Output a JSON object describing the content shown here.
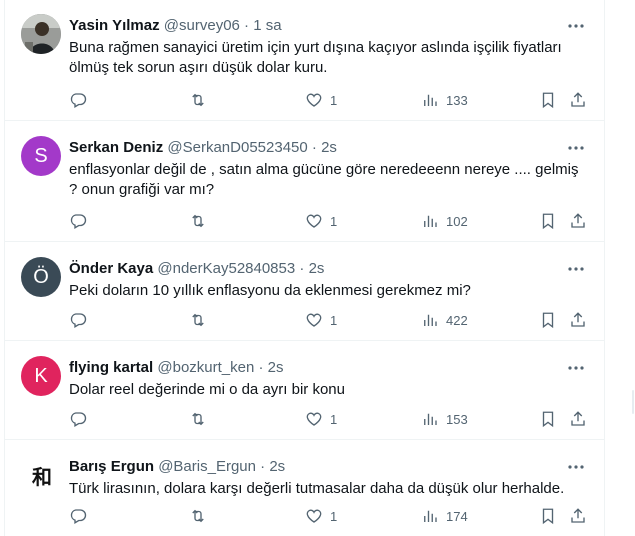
{
  "tweets": [
    {
      "name": "Yasin Yılmaz",
      "handle": "@survey06",
      "sep": "·",
      "time": "1 sa",
      "text": "Buna rağmen sanayici üretim için yurt dışına kaçıyor aslında işçilik fiyatları ölmüş tek sorun aşırı düşük dolar kuru.",
      "likes": "1",
      "views": "133",
      "avatar": {
        "type": "photo",
        "color": "#8b8f90"
      }
    },
    {
      "name": "Serkan Deniz",
      "handle": "@SerkanD05523450",
      "sep": "·",
      "time": "2s",
      "text": "enflasyonlar değil de , satın alma gücüne göre neredeeenn nereye .... gelmiş ? onun grafiği var mı?",
      "likes": "1",
      "views": "102",
      "avatar": {
        "type": "letter",
        "letter": "S",
        "color": "#a339c9"
      }
    },
    {
      "name": "Önder Kaya",
      "handle": "@nderKay52840853",
      "sep": "·",
      "time": "2s",
      "text": "Peki doların 10 yıllık enflasyonu da eklenmesi gerekmez mi?",
      "likes": "1",
      "views": "422",
      "avatar": {
        "type": "letter",
        "letter": "Ö",
        "color": "#3a4a56"
      }
    },
    {
      "name": "flying kartal",
      "handle": "@bozkurt_ken",
      "sep": "·",
      "time": "2s",
      "text": "Dolar reel değerinde mi o da ayrı bir konu",
      "likes": "1",
      "views": "153",
      "avatar": {
        "type": "letter",
        "letter": "K",
        "color": "#e0245e"
      }
    },
    {
      "name": "Barış Ergun",
      "handle": "@Baris_Ergun",
      "sep": "·",
      "time": "2s",
      "text": "Türk lirasının, dolara karşı değerli tutmasalar daha da düşük olur herhalde.",
      "likes": "1",
      "views": "174",
      "avatar": {
        "type": "glyph",
        "letter": "和",
        "color": "#ffffff"
      }
    }
  ],
  "icons": {
    "reply": "reply-icon",
    "retweet": "retweet-icon",
    "like": "heart-icon",
    "views": "views-icon",
    "bookmark": "bookmark-icon",
    "share": "share-icon",
    "more": "more-icon"
  }
}
